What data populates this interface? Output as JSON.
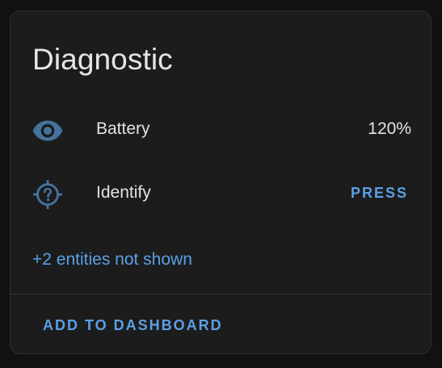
{
  "card": {
    "title": "Diagnostic",
    "entities": [
      {
        "name": "Battery",
        "state": "120%",
        "icon": "eye-icon"
      },
      {
        "name": "Identify",
        "action_label": "PRESS",
        "icon": "crosshairs-question-icon"
      }
    ],
    "hidden_entities_text": "+2 entities not shown",
    "add_to_dashboard_label": "ADD TO DASHBOARD"
  },
  "colors": {
    "background": "#111111",
    "card_background": "#1c1c1c",
    "text_primary": "#e2e2e2",
    "accent": "#5aa0e6",
    "icon": "#44739e"
  }
}
